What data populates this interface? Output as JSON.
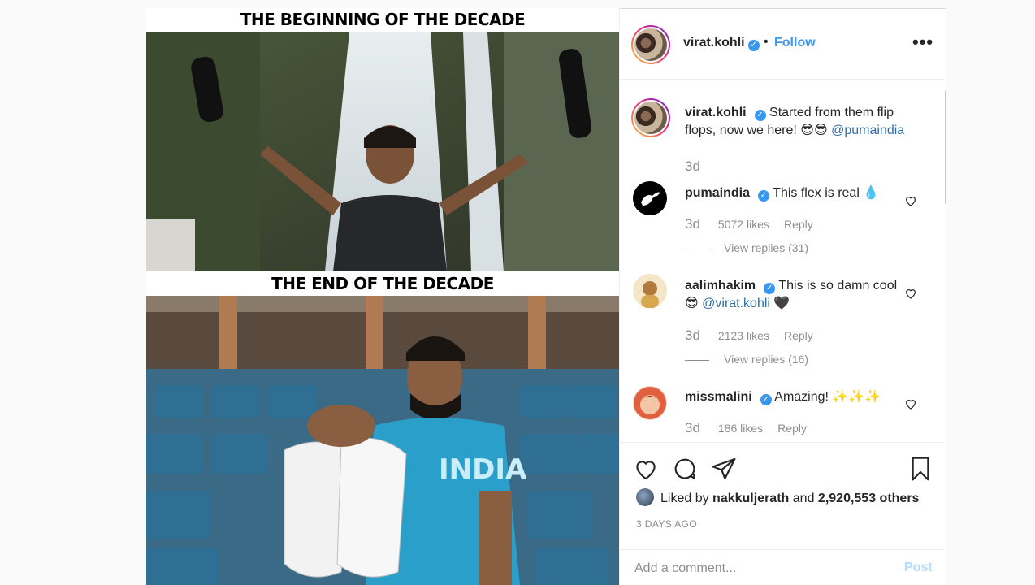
{
  "media": {
    "caption_top": "THE BEGINNING OF THE DECADE",
    "caption_bottom": "THE END OF THE DECADE",
    "photo_top": "person-holding-flip-flops-at-waterfall",
    "photo_bottom": "person-holding-sneakers-in-stadium",
    "shirt_text": "INDIA"
  },
  "header": {
    "username": "virat.kohli",
    "separator": "•",
    "follow_label": "Follow",
    "more_label": "•••"
  },
  "caption": {
    "username": "virat.kohli",
    "text": "Started from them flip flops, now we here! 😎😎",
    "mention": "@pumaindia",
    "time": "3d"
  },
  "comments": [
    {
      "username": "pumaindia",
      "text": "This flex is real 💧",
      "mention": "",
      "time": "3d",
      "likes": "5072 likes",
      "reply": "Reply",
      "view_replies": "View replies (31)"
    },
    {
      "username": "aalimhakim",
      "text": "This is so damn cool 😎",
      "mention": "@virat.kohli",
      "suffix": "🖤",
      "time": "3d",
      "likes": "2123 likes",
      "reply": "Reply",
      "view_replies": "View replies (16)"
    },
    {
      "username": "missmalini",
      "text": "Amazing! ✨✨✨",
      "mention": "",
      "time": "3d",
      "likes": "186 likes",
      "reply": "Reply"
    }
  ],
  "actions": {
    "icons": [
      "heart-icon",
      "comment-icon",
      "share-icon",
      "bookmark-icon"
    ]
  },
  "likes": {
    "prefix": "Liked by",
    "user": "nakkuljerath",
    "middle": "and",
    "count": "2,920,553 others"
  },
  "timestamp": "3 DAYS AGO",
  "comment_box": {
    "placeholder": "Add a comment...",
    "post_label": "Post"
  },
  "colors": {
    "link": "#3897f0",
    "muted": "#8e8e8e",
    "post_disabled": "#b3dbff"
  }
}
